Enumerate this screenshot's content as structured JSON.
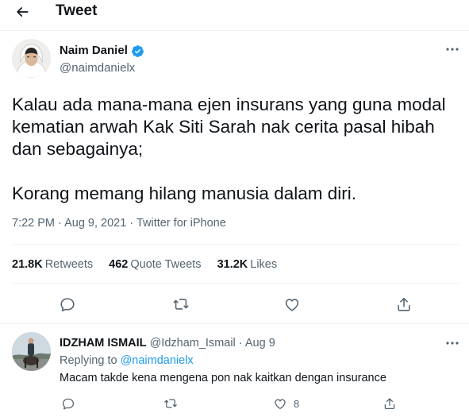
{
  "header": {
    "title": "Tweet",
    "back_icon": "arrow-left-icon"
  },
  "tweet": {
    "author": {
      "name": "Naim Daniel",
      "handle": "@naimdanielx",
      "verified": true
    },
    "text": "Kalau ada mana-mana ejen insurans yang guna modal kematian arwah Kak Siti Sarah nak cerita pasal hibah dan sebagainya;\n\nKorang memang hilang manusia dalam diri.",
    "time": "7:22 PM",
    "date": "Aug 9, 2021",
    "source": "Twitter for iPhone",
    "stats": {
      "retweets_count": "21.8K",
      "retweets_label": "Retweets",
      "quotes_count": "462",
      "quotes_label": "Quote Tweets",
      "likes_count": "31.2K",
      "likes_label": "Likes"
    },
    "actions": [
      "reply-icon",
      "retweet-icon",
      "like-icon",
      "share-icon"
    ]
  },
  "reply": {
    "author": {
      "name": "IDZHAM ISMAIL",
      "handle": "@Idzham_Ismail",
      "date": "Aug 9"
    },
    "replying_prefix": "Replying to",
    "replying_to": "@naimdanielx",
    "text": "Macam takde kena mengena pon nak kaitkan dengan insurance",
    "like_count": "8"
  },
  "colors": {
    "accent": "#1d9bf0",
    "text": "#0f1419",
    "secondary": "#536471",
    "divider": "#eff3f4"
  }
}
